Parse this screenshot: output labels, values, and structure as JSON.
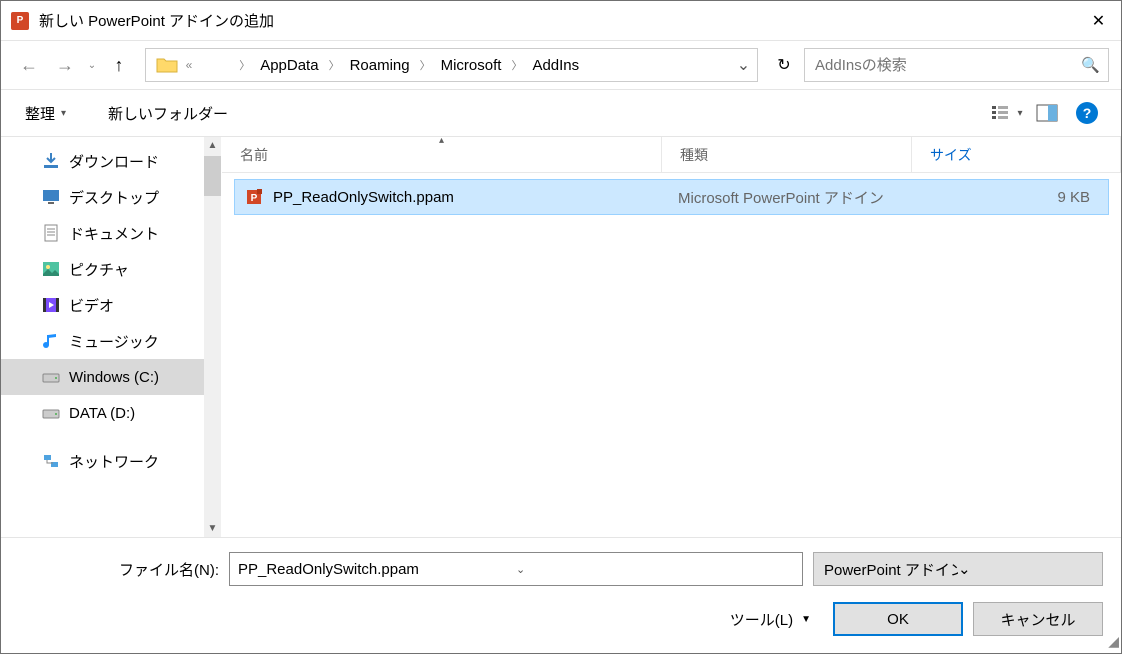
{
  "title": "新しい PowerPoint アドインの追加",
  "breadcrumb": [
    "AppData",
    "Roaming",
    "Microsoft",
    "AddIns"
  ],
  "search_placeholder": "AddInsの検索",
  "toolbar": {
    "organize": "整理",
    "new_folder": "新しいフォルダー"
  },
  "tree": [
    {
      "label": "ダウンロード",
      "icon": "download"
    },
    {
      "label": "デスクトップ",
      "icon": "desktop"
    },
    {
      "label": "ドキュメント",
      "icon": "document"
    },
    {
      "label": "ピクチャ",
      "icon": "pictures"
    },
    {
      "label": "ビデオ",
      "icon": "videos"
    },
    {
      "label": "ミュージック",
      "icon": "music"
    },
    {
      "label": "Windows (C:)",
      "icon": "drive",
      "selected": true
    },
    {
      "label": "DATA (D:)",
      "icon": "drive"
    }
  ],
  "tree_network": "ネットワーク",
  "cols": {
    "name": "名前",
    "type": "種類",
    "size": "サイズ"
  },
  "files": [
    {
      "name": "PP_ReadOnlySwitch.ppam",
      "type": "Microsoft PowerPoint アドイン",
      "size": "9 KB",
      "selected": true
    }
  ],
  "filename_label": "ファイル名(N):",
  "filename_value": "PP_ReadOnlySwitch.ppam",
  "filter_label": "PowerPoint アドイン (*.ppam;*.pp",
  "tools_label": "ツール(L)",
  "ok": "OK",
  "cancel": "キャンセル"
}
